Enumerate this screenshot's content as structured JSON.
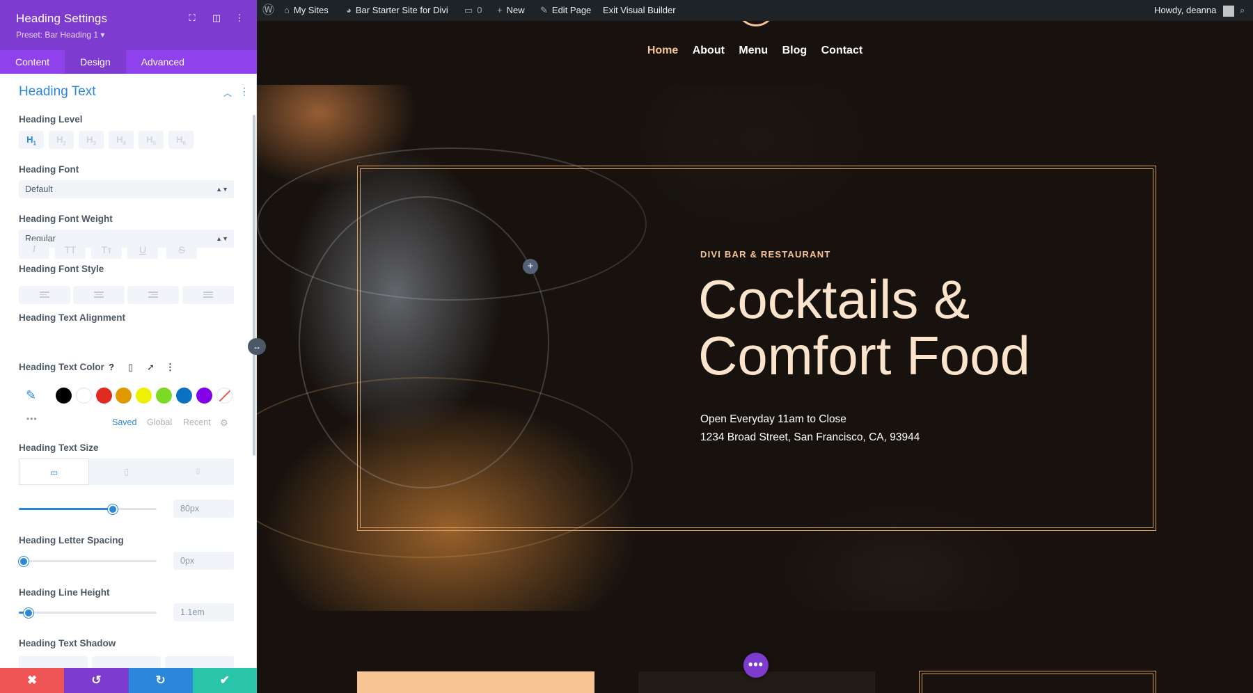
{
  "panel": {
    "title": "Heading Settings",
    "preset": "Preset: Bar Heading 1 ▾",
    "header_icons": [
      "fullscreen-icon",
      "sidebar-layout-icon",
      "more-vertical-icon"
    ],
    "tabs": [
      {
        "label": "Content",
        "active": false
      },
      {
        "label": "Design",
        "active": true
      },
      {
        "label": "Advanced",
        "active": false
      }
    ],
    "section": {
      "title": "Heading Text",
      "collapse_icon": "chevron-up-icon",
      "menu_icon": "more-vertical-icon"
    },
    "heading_level": {
      "label": "Heading Level",
      "options": [
        {
          "main": "H",
          "sub": "1",
          "active": true
        },
        {
          "main": "H",
          "sub": "2",
          "active": false
        },
        {
          "main": "H",
          "sub": "3",
          "active": false
        },
        {
          "main": "H",
          "sub": "4",
          "active": false
        },
        {
          "main": "H",
          "sub": "5",
          "active": false
        },
        {
          "main": "H",
          "sub": "6",
          "active": false
        }
      ]
    },
    "heading_font": {
      "label": "Heading Font",
      "value": "Default"
    },
    "heading_font_weight": {
      "label": "Heading Font Weight",
      "value": "Regular"
    },
    "heading_font_style": {
      "label": "Heading Font Style",
      "options": [
        {
          "glyph": "I",
          "icon": "italic-icon"
        },
        {
          "glyph": "TT",
          "icon": "uppercase-icon"
        },
        {
          "glyph": "Tт",
          "icon": "capitalize-icon"
        },
        {
          "glyph": "U",
          "icon": "underline-icon"
        },
        {
          "glyph": "S",
          "icon": "strikethrough-icon"
        }
      ]
    },
    "heading_text_alignment": {
      "label": "Heading Text Alignment",
      "options": [
        "align-left-icon",
        "align-center-icon",
        "align-right-icon",
        "align-justify-icon"
      ]
    },
    "heading_text_color": {
      "label": "Heading Text Color",
      "icons": [
        "help-icon",
        "mobile-icon",
        "cursor-hover-icon",
        "more-vertical-icon"
      ],
      "picker_icon": "eyedropper-icon",
      "swatches": [
        "#000000",
        "#ffffff",
        "#e02b20",
        "#e09900",
        "#edf000",
        "#7cda24",
        "#0c71c3",
        "#8300e9"
      ],
      "more_label": "•••",
      "tabs": [
        {
          "label": "Saved",
          "active": true
        },
        {
          "label": "Global",
          "active": false
        },
        {
          "label": "Recent",
          "active": false
        }
      ],
      "settings_icon": "gear-icon"
    },
    "heading_text_size": {
      "label": "Heading Text Size",
      "devices": [
        {
          "icon": "desktop-icon",
          "glyph": "▭",
          "active": true
        },
        {
          "icon": "tablet-icon",
          "glyph": "▯",
          "active": false
        },
        {
          "icon": "phone-icon",
          "glyph": "▯",
          "active": false
        }
      ],
      "value": "80px",
      "slider_fraction": 0.68
    },
    "heading_letter_spacing": {
      "label": "Heading Letter Spacing",
      "value": "0px",
      "slider_fraction": 0.03
    },
    "heading_line_height": {
      "label": "Heading Line Height",
      "value": "1.1em",
      "slider_fraction": 0.07
    },
    "heading_text_shadow": {
      "label": "Heading Text Shadow"
    },
    "footer": [
      {
        "icon": "close-icon",
        "glyph": "✖",
        "color": "#ef5555"
      },
      {
        "icon": "undo-icon",
        "glyph": "↺",
        "color": "#7e3bd0"
      },
      {
        "icon": "redo-icon",
        "glyph": "↻",
        "color": "#2b87da"
      },
      {
        "icon": "save-check-icon",
        "glyph": "✔",
        "color": "#29c4a9"
      }
    ]
  },
  "adminbar": {
    "wp_icon": "wordpress-icon",
    "my_sites": "My Sites",
    "site_name": "Bar Starter Site for Divi",
    "comments": "0",
    "new": "New",
    "edit_page": "Edit Page",
    "exit_builder": "Exit Visual Builder",
    "howdy": "Howdy, deanna",
    "search_icon": "search-icon"
  },
  "site": {
    "nav": [
      {
        "label": "Home",
        "active": true
      },
      {
        "label": "About",
        "active": false
      },
      {
        "label": "Menu",
        "active": false
      },
      {
        "label": "Blog",
        "active": false
      },
      {
        "label": "Contact",
        "active": false
      }
    ],
    "hero": {
      "eyebrow": "DIVI BAR & RESTAURANT",
      "heading_line1": "Cocktails &",
      "heading_line2": "Comfort Food",
      "hours": "Open Everyday 11am to Close",
      "address": "1234 Broad Street, San Francisco, CA, 93944",
      "add_icon": "plus-icon"
    },
    "fab_label": "•••",
    "colors": {
      "accent": "#f7c493",
      "builder_purple": "#7e3bd0",
      "builder_blue": "#2b87da"
    }
  }
}
